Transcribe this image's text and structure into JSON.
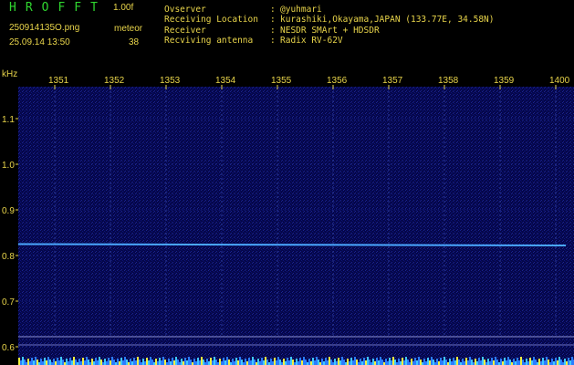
{
  "header": {
    "title": "HROFFT",
    "version": "1.00f",
    "filename": "250914135O.png",
    "datetime": "25.09.14 13:50",
    "mode": "meteor",
    "count": "38"
  },
  "station": {
    "rows": [
      {
        "label": "Ovserver",
        "sep": ":",
        "value": "@yuhmari"
      },
      {
        "label": "Receiving Location",
        "sep": ":",
        "value": "kurashiki,Okayama,JAPAN (133.77E, 34.58N)"
      },
      {
        "label": "Receiver",
        "sep": ":",
        "value": "NESDR SMArt + HDSDR"
      },
      {
        "label": "Recviving antenna",
        "sep": ":",
        "value": "Radix RV-62V"
      }
    ]
  },
  "colors": {
    "text": "#e8d44a",
    "title": "#2fd62f",
    "signal": "#4aa8ff",
    "noise": "#0a0e5a"
  },
  "chart_data": {
    "type": "heatmap",
    "xlabel": "",
    "ylabel": "kHz",
    "x_ticks": [
      "1351",
      "1352",
      "1353",
      "1354",
      "1355",
      "1356",
      "1357",
      "1358",
      "1359",
      "1400"
    ],
    "y_ticks": [
      "1.1",
      "1.0",
      "0.9",
      "0.8",
      "0.7",
      "0.6"
    ],
    "ylim": [
      0.58,
      1.19
    ],
    "series": [
      {
        "values": [
          [
            1351,
            0.825
          ],
          [
            1400,
            0.822
          ]
        ]
      }
    ],
    "grid": true
  }
}
